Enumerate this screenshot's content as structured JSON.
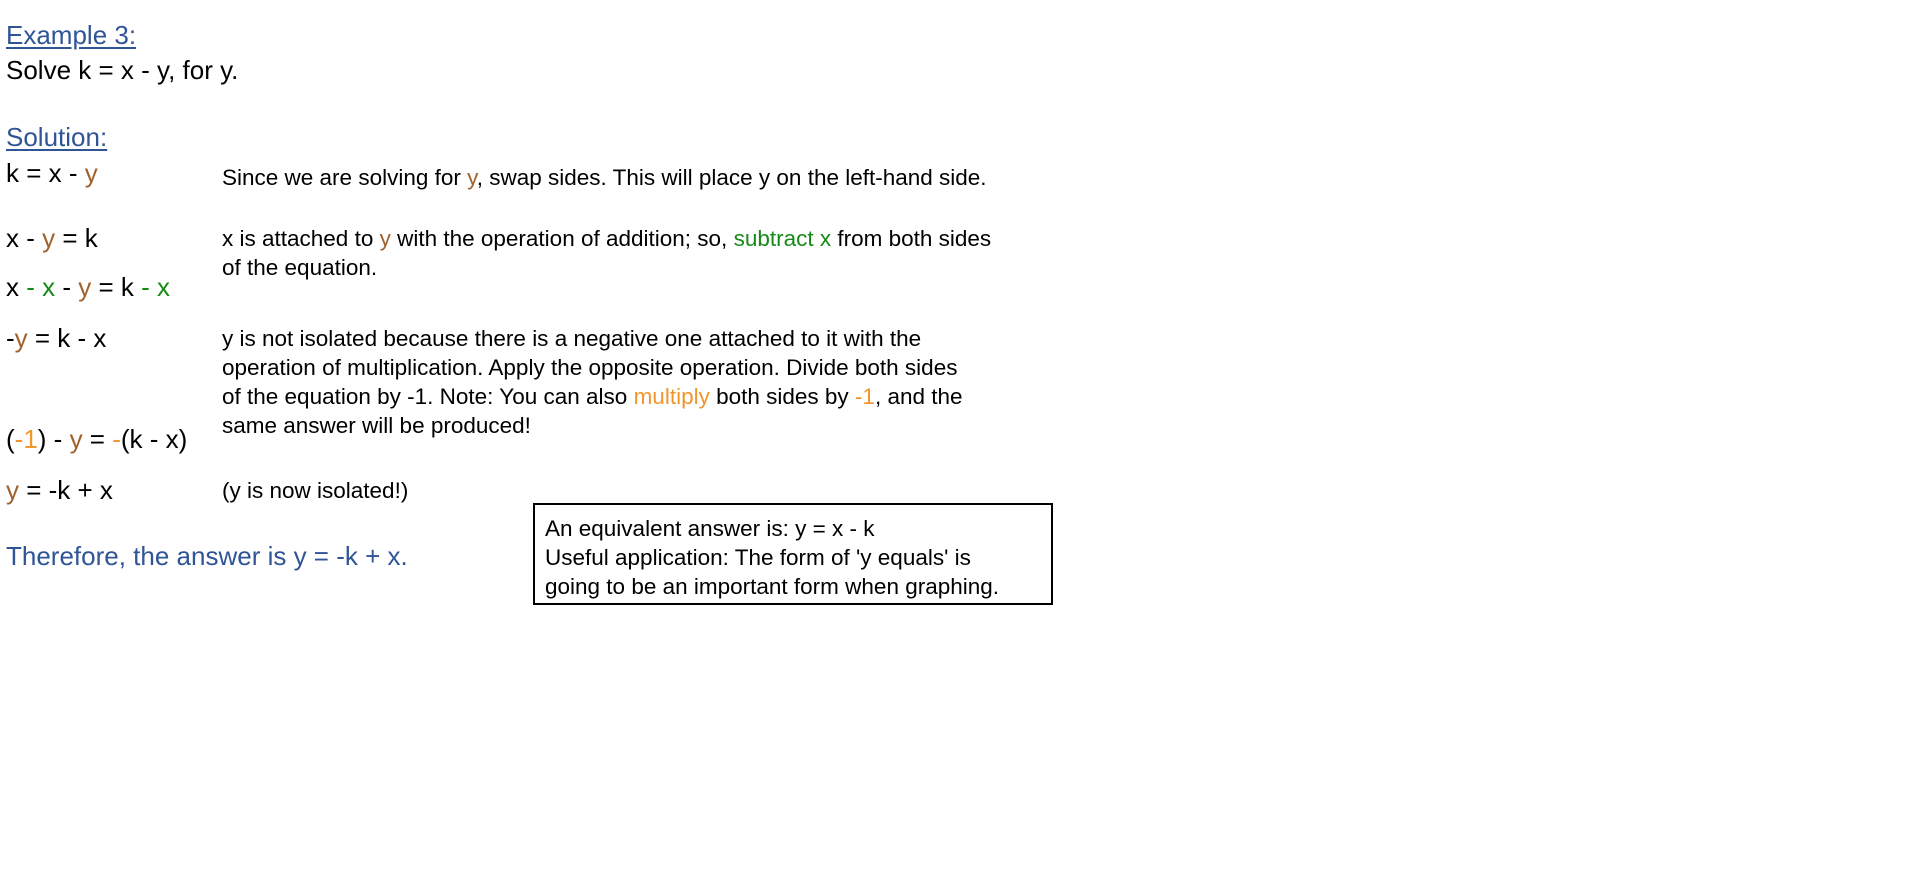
{
  "example": {
    "heading": "Example 3:",
    "problem": "Solve k = x - y, for y."
  },
  "solution": {
    "heading": "Solution:",
    "steps": [
      {
        "parts": [
          "k = x - ",
          "y"
        ]
      },
      {
        "parts": [
          "x - ",
          "y",
          " = k"
        ]
      },
      {
        "parts": [
          "x ",
          "- x",
          " - ",
          "y",
          " = k ",
          "- x"
        ]
      },
      {
        "parts": [
          "-",
          "y",
          " = k - x"
        ]
      },
      {
        "parts": [
          "(",
          "-1",
          ") - ",
          "y",
          " = ",
          "-",
          "(k - x)"
        ]
      },
      {
        "parts": [
          "y",
          " = -k + x"
        ]
      }
    ],
    "explanations": {
      "swap": [
        "Since we are solving for ",
        "y",
        ", swap sides.  This will place y on the left-hand side."
      ],
      "subtract_line1": [
        "x is attached to ",
        "y",
        " with the operation of addition; so, ",
        "subtract x",
        " from both sides"
      ],
      "subtract_line2": "of the equation.",
      "divide_line1": "y is not isolated because there is a negative one attached to it with the",
      "divide_line2": "operation of multiplication.  Apply the opposite operation.  Divide both sides",
      "divide_line3": [
        "of the equation by -1.  Note:  You can also ",
        "multiply",
        " both sides by ",
        "-1",
        ", and the"
      ],
      "divide_line4": "same answer will be produced!",
      "isolated": "(y is now isolated!)"
    },
    "answer": "Therefore, the answer is y = -k + x."
  },
  "callout": {
    "line1": "An equivalent answer is:  y = x - k",
    "line2": "Useful application:  The form of 'y equals' is",
    "line3": "going to be an important form when graphing."
  },
  "colors": {
    "heading_blue": "#2F5597",
    "variable_y": "#A0622D",
    "subtract_green": "#168A16",
    "negative_one_orange": "#F0962D"
  }
}
